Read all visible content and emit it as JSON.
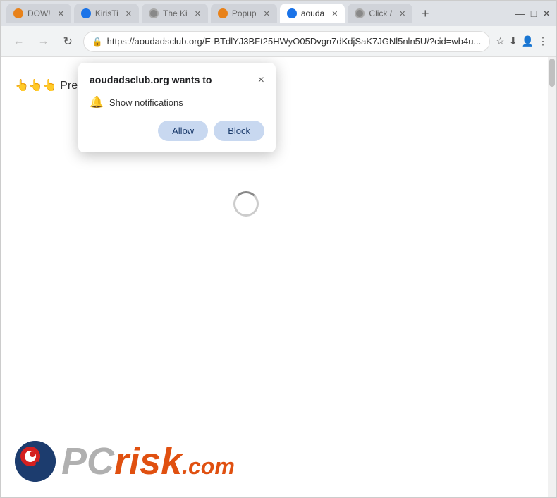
{
  "browser": {
    "tabs": [
      {
        "id": "tab1",
        "label": "DOW!",
        "favicon": "orange",
        "active": false
      },
      {
        "id": "tab2",
        "label": "KirisTi",
        "favicon": "blue",
        "active": false
      },
      {
        "id": "tab3",
        "label": "The Ki",
        "favicon": "gray",
        "active": false
      },
      {
        "id": "tab4",
        "label": "Popup",
        "favicon": "orange",
        "active": false
      },
      {
        "id": "tab5",
        "label": "aouda",
        "favicon": "blue",
        "active": true
      },
      {
        "id": "tab6",
        "label": "Click /",
        "favicon": "gray",
        "active": false
      }
    ],
    "url": "https://aoudadsclub.org/E-BTdlYJ3BFt25HWyO05Dvgn7dKdjSaK7JGNl5nln5U/?cid=wb4u...",
    "window_controls": [
      "—",
      "□",
      "✕"
    ]
  },
  "popup": {
    "title": "aoudadsclub.org wants to",
    "close_label": "×",
    "notification_label": "Show notifications",
    "allow_label": "Allow",
    "block_label": "Block"
  },
  "page": {
    "press_allow_text": "👆👆👆 Press Allow to proceed"
  },
  "logo": {
    "pc_text": "PC",
    "risk_text": "risk",
    "com_text": ".com"
  }
}
